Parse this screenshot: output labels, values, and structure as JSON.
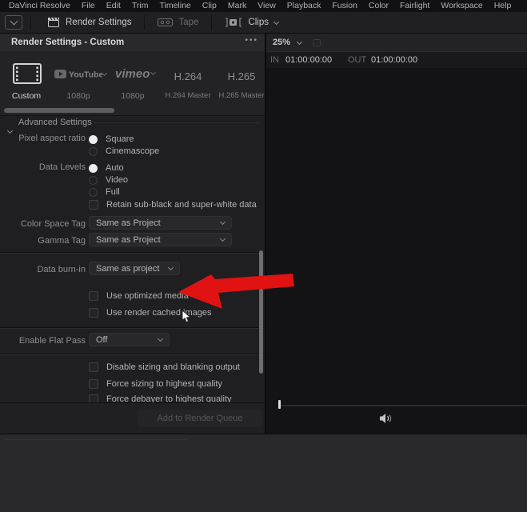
{
  "menu_bar": {
    "items": [
      "DaVinci Resolve",
      "File",
      "Edit",
      "Trim",
      "Timeline",
      "Clip",
      "Mark",
      "View",
      "Playback",
      "Fusion",
      "Color",
      "Fairlight",
      "Workspace",
      "Help"
    ]
  },
  "toolbar": {
    "render_settings": "Render Settings",
    "tape": "Tape",
    "clips": "Clips"
  },
  "render_panel": {
    "title": "Render Settings - Custom",
    "presets": {
      "custom": {
        "label": "Custom"
      },
      "youtube": {
        "logo": "YouTube",
        "sub": "1080p"
      },
      "vimeo": {
        "logo": "vimeo",
        "sub": "1080p"
      },
      "h264": {
        "title": "H.264",
        "sub": "H.264 Master"
      },
      "h265": {
        "title": "H.265",
        "sub": "H.265 Master"
      }
    },
    "settings": {
      "advanced_header": "Advanced Settings",
      "pixel_aspect_ratio_label": "Pixel aspect ratio",
      "pixel_aspect_square": "Square",
      "pixel_aspect_cinemascope": "Cinemascope",
      "data_levels_label": "Data Levels",
      "data_levels_auto": "Auto",
      "data_levels_video": "Video",
      "data_levels_full": "Full",
      "retain_label": "Retain sub-black and super-white data",
      "color_space_tag_label": "Color Space Tag",
      "color_space_tag_value": "Same as Project",
      "gamma_tag_label": "Gamma Tag",
      "gamma_tag_value": "Same as Project",
      "data_burn_in_label": "Data burn-in",
      "data_burn_in_value": "Same as project",
      "use_optimized_media": "Use optimized media",
      "use_render_cached": "Use render cached images",
      "enable_flat_pass_label": "Enable Flat Pass",
      "enable_flat_pass_value": "Off",
      "disable_sizing": "Disable sizing and blanking output",
      "force_sizing": "Force sizing to highest quality",
      "force_debayer": "Force debayer to highest quality"
    },
    "footer": {
      "add_to_queue": "Add to Render Queue"
    }
  },
  "viewer": {
    "zoom_level": "25%",
    "in_label": "IN",
    "in_value": "01:00:00:00",
    "out_label": "OUT",
    "out_value": "01:00:00:00"
  },
  "annotation": {
    "arrow_color": "#e01212"
  }
}
